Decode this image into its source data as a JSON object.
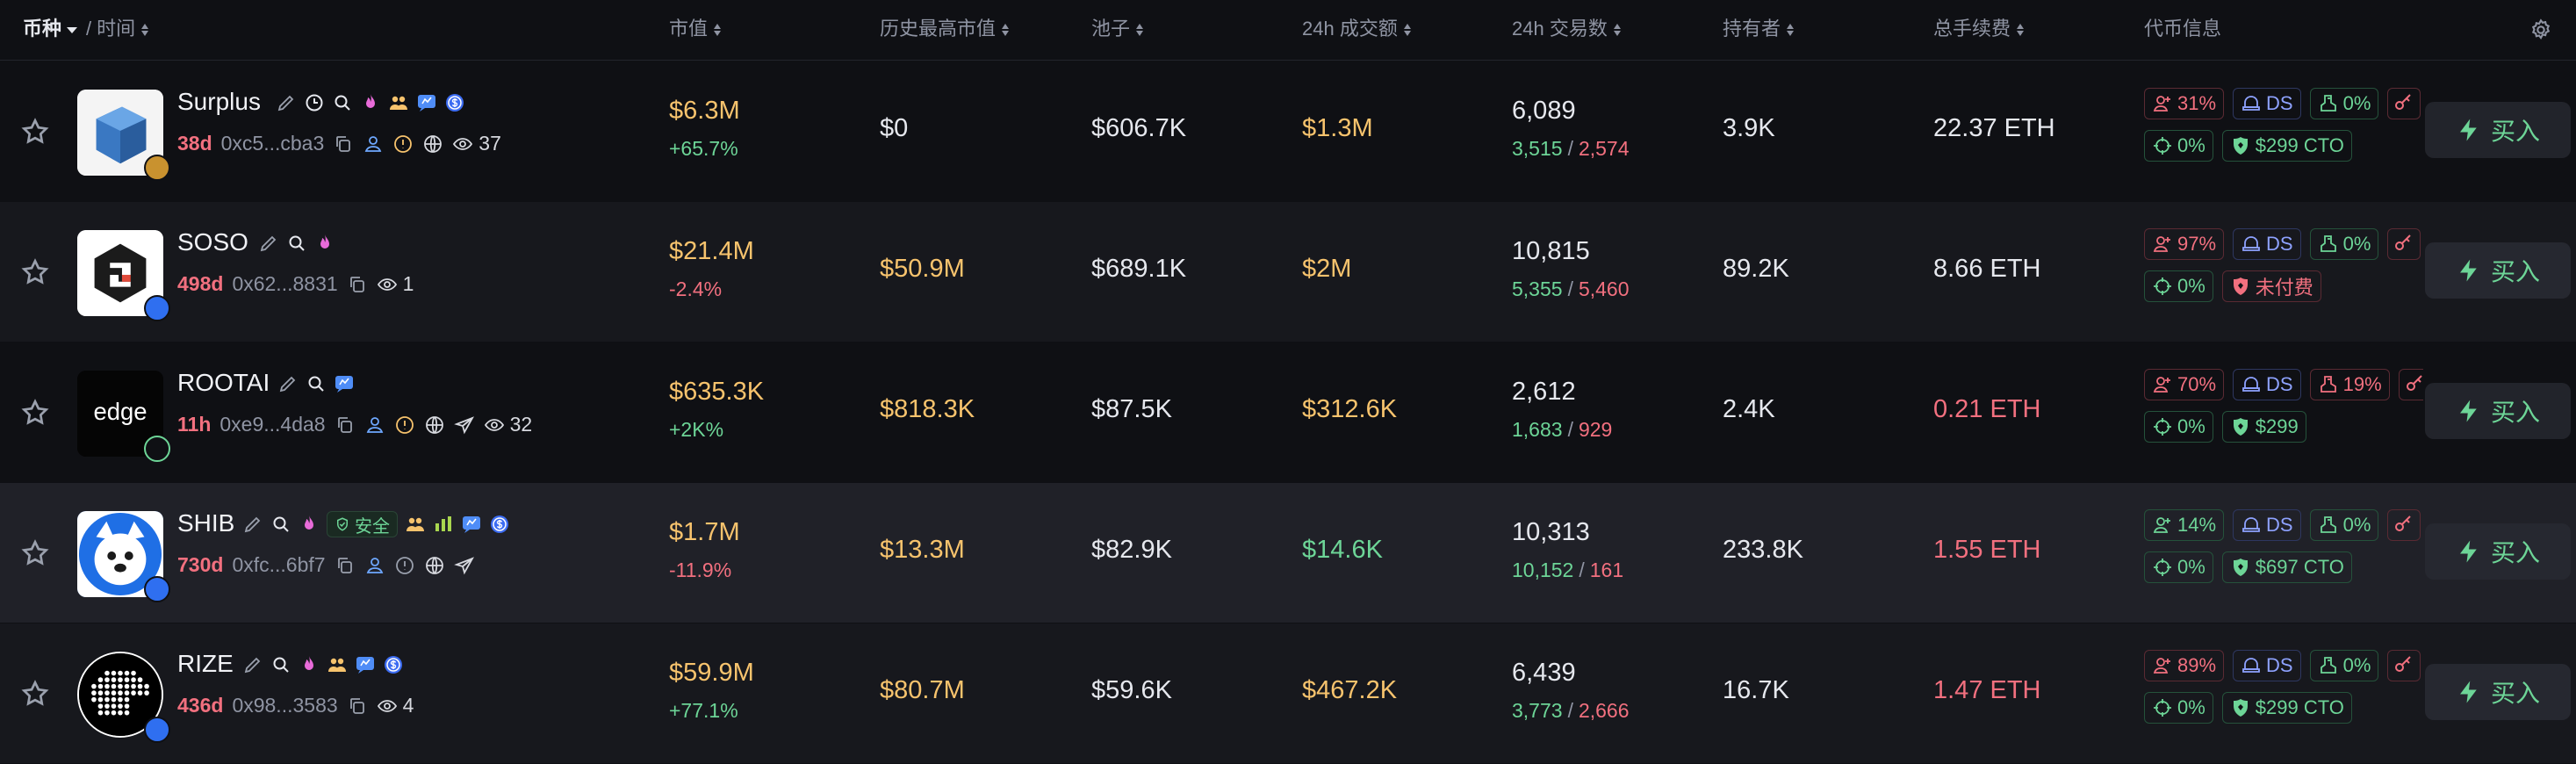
{
  "header": {
    "coin_label": "币种",
    "time_label": "时间",
    "sep": "/",
    "market_cap": "市值",
    "ath_cap": "历史最高市值",
    "pool": "池子",
    "vol_24h": "24h 成交额",
    "txns_24h": "24h 交易数",
    "holders": "持有者",
    "total_fees": "总手续费",
    "token_info": "代币信息"
  },
  "colors": {
    "background": "#0f1014",
    "row_alt": "#17181d",
    "row_highlight": "#202128",
    "positive": "#6dd597",
    "negative": "#f2707f",
    "accent_yellow": "#f7c36d",
    "muted": "#8f94a3"
  },
  "buy_label": "买入",
  "rows": [
    {
      "name": "Surplus",
      "age": "38d",
      "address": "0xc5...cba3",
      "views": "37",
      "market_cap": "$6.3M",
      "change": "+65.7%",
      "ath": "$0",
      "pool": "$606.7K",
      "volume": "$1.3M",
      "txns": "6,089",
      "buys": "3,515",
      "sells": "2,574",
      "holders": "3.9K",
      "fees": "22.37 ETH",
      "tag_top10": "31%",
      "tag_ds": "DS",
      "tag_insider": "0%",
      "tag_snipe": "0%",
      "tag_dex": "$299 CTO"
    },
    {
      "name": "SOSO",
      "age": "498d",
      "address": "0x62...8831",
      "views": "1",
      "market_cap": "$21.4M",
      "change": "-2.4%",
      "ath": "$50.9M",
      "pool": "$689.1K",
      "volume": "$2M",
      "txns": "10,815",
      "buys": "5,355",
      "sells": "5,460",
      "holders": "89.2K",
      "fees": "8.66 ETH",
      "tag_top10": "97%",
      "tag_ds": "DS",
      "tag_insider": "0%",
      "tag_snipe": "0%",
      "tag_dex": "未付费"
    },
    {
      "name": "ROOTAI",
      "age": "11h",
      "address": "0xe9...4da8",
      "views": "32",
      "market_cap": "$635.3K",
      "change": "+2K%",
      "ath": "$818.3K",
      "pool": "$87.5K",
      "volume": "$312.6K",
      "txns": "2,612",
      "buys": "1,683",
      "sells": "929",
      "holders": "2.4K",
      "fees": "0.21 ETH",
      "tag_top10": "70%",
      "tag_ds": "DS",
      "tag_insider": "19%",
      "tag_snipe": "0%",
      "tag_dex": "$299"
    },
    {
      "name": "SHIB",
      "age": "730d",
      "address": "0xfc...6bf7",
      "views": "",
      "safe_label": "安全",
      "market_cap": "$1.7M",
      "change": "-11.9%",
      "ath": "$13.3M",
      "pool": "$82.9K",
      "volume": "$14.6K",
      "txns": "10,313",
      "buys": "10,152",
      "sells": "161",
      "holders": "233.8K",
      "fees": "1.55 ETH",
      "tag_top10": "14%",
      "tag_ds": "DS",
      "tag_insider": "0%",
      "tag_snipe": "0%",
      "tag_dex": "$697 CTO"
    },
    {
      "name": "RIZE",
      "age": "436d",
      "address": "0x98...3583",
      "views": "4",
      "market_cap": "$59.9M",
      "change": "+77.1%",
      "ath": "$80.7M",
      "pool": "$59.6K",
      "volume": "$467.2K",
      "txns": "6,439",
      "buys": "3,773",
      "sells": "2,666",
      "holders": "16.7K",
      "fees": "1.47 ETH",
      "tag_top10": "89%",
      "tag_ds": "DS",
      "tag_insider": "0%",
      "tag_snipe": "0%",
      "tag_dex": "$299 CTO"
    }
  ]
}
